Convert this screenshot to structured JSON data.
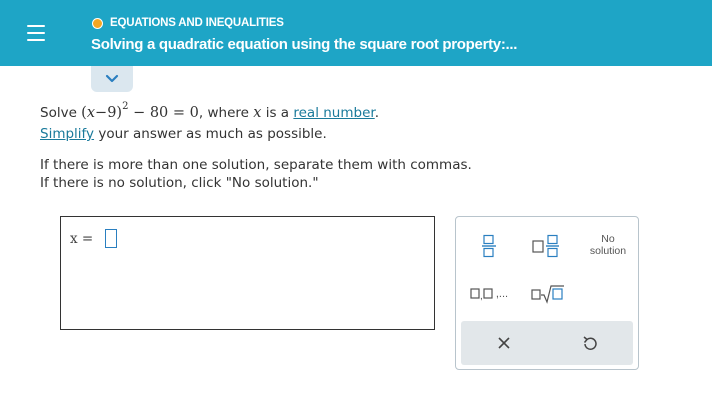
{
  "header": {
    "topic": "EQUATIONS AND INEQUALITIES",
    "title": "Solving a quadratic equation using the square root property:..."
  },
  "problem": {
    "solve_word": "Solve",
    "eq_lhs_x": "x",
    "eq_lhs_minus": "−",
    "eq_lhs_9": "9",
    "eq_exp": "2",
    "eq_rest": "− 80 = 0",
    "where_text": ", where",
    "var_x": "x",
    "is_a": "is a",
    "real_number_link": "real number",
    "period": ".",
    "simplify_link": "Simplify",
    "simplify_rest": "your answer as much as possible.",
    "instr_line1": "If there is more than one solution, separate them with commas.",
    "instr_line2": "If there is no solution, click \"No solution.\""
  },
  "answer": {
    "variable_label": "x =",
    "value": ""
  },
  "keypad": {
    "no_solution_line1": "No",
    "no_solution_line2": "solution",
    "list_ellipsis": ",..."
  },
  "colors": {
    "header_bg": "#1ea5c6",
    "topic_dot": "#f5a623",
    "link": "#1a7a9b",
    "keypad_icon": "#2a7fc0"
  },
  "icons": {
    "menu": "hamburger-icon",
    "collapse": "chevron-down-icon",
    "clear": "x-icon",
    "undo": "undo-icon"
  }
}
